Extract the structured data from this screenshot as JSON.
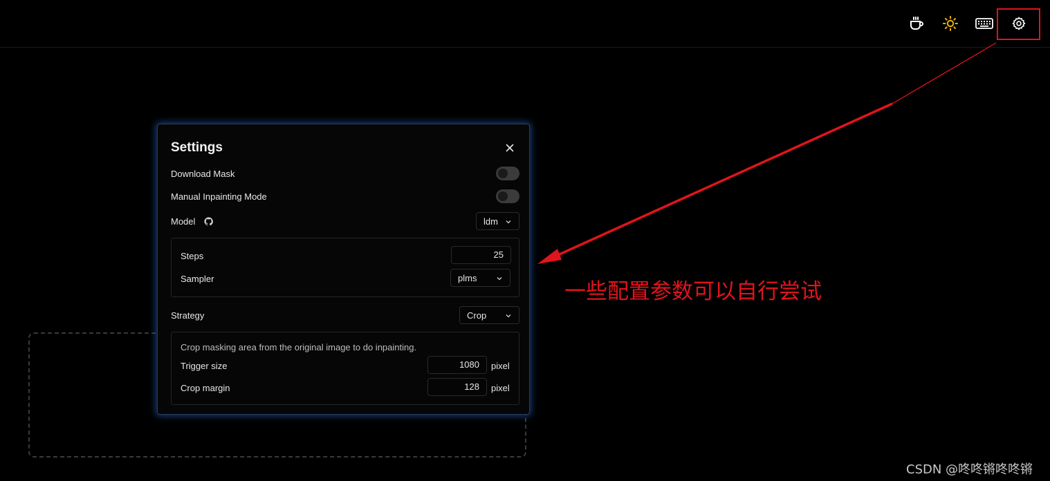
{
  "header": {
    "icons": [
      "coffee-icon",
      "sun-icon",
      "keyboard-icon",
      "gear-icon"
    ],
    "sun_color": "#f0b400"
  },
  "settings": {
    "title": "Settings",
    "download_mask": {
      "label": "Download Mask",
      "enabled": false
    },
    "manual_inpainting": {
      "label": "Manual Inpainting Mode",
      "enabled": false
    },
    "model": {
      "label": "Model",
      "value": "ldm"
    },
    "steps": {
      "label": "Steps",
      "value": "25"
    },
    "sampler": {
      "label": "Sampler",
      "value": "plms"
    },
    "strategy": {
      "label": "Strategy",
      "value": "Crop"
    },
    "crop": {
      "description": "Crop masking area from the original image to do inpainting.",
      "trigger_size": {
        "label": "Trigger size",
        "value": "1080",
        "unit": "pixel"
      },
      "crop_margin": {
        "label": "Crop margin",
        "value": "128",
        "unit": "pixel"
      }
    }
  },
  "annotation": {
    "text": "一些配置参数可以自行尝试",
    "color": "#e0141c"
  },
  "watermark": "CSDN @咚咚锵咚咚锵"
}
